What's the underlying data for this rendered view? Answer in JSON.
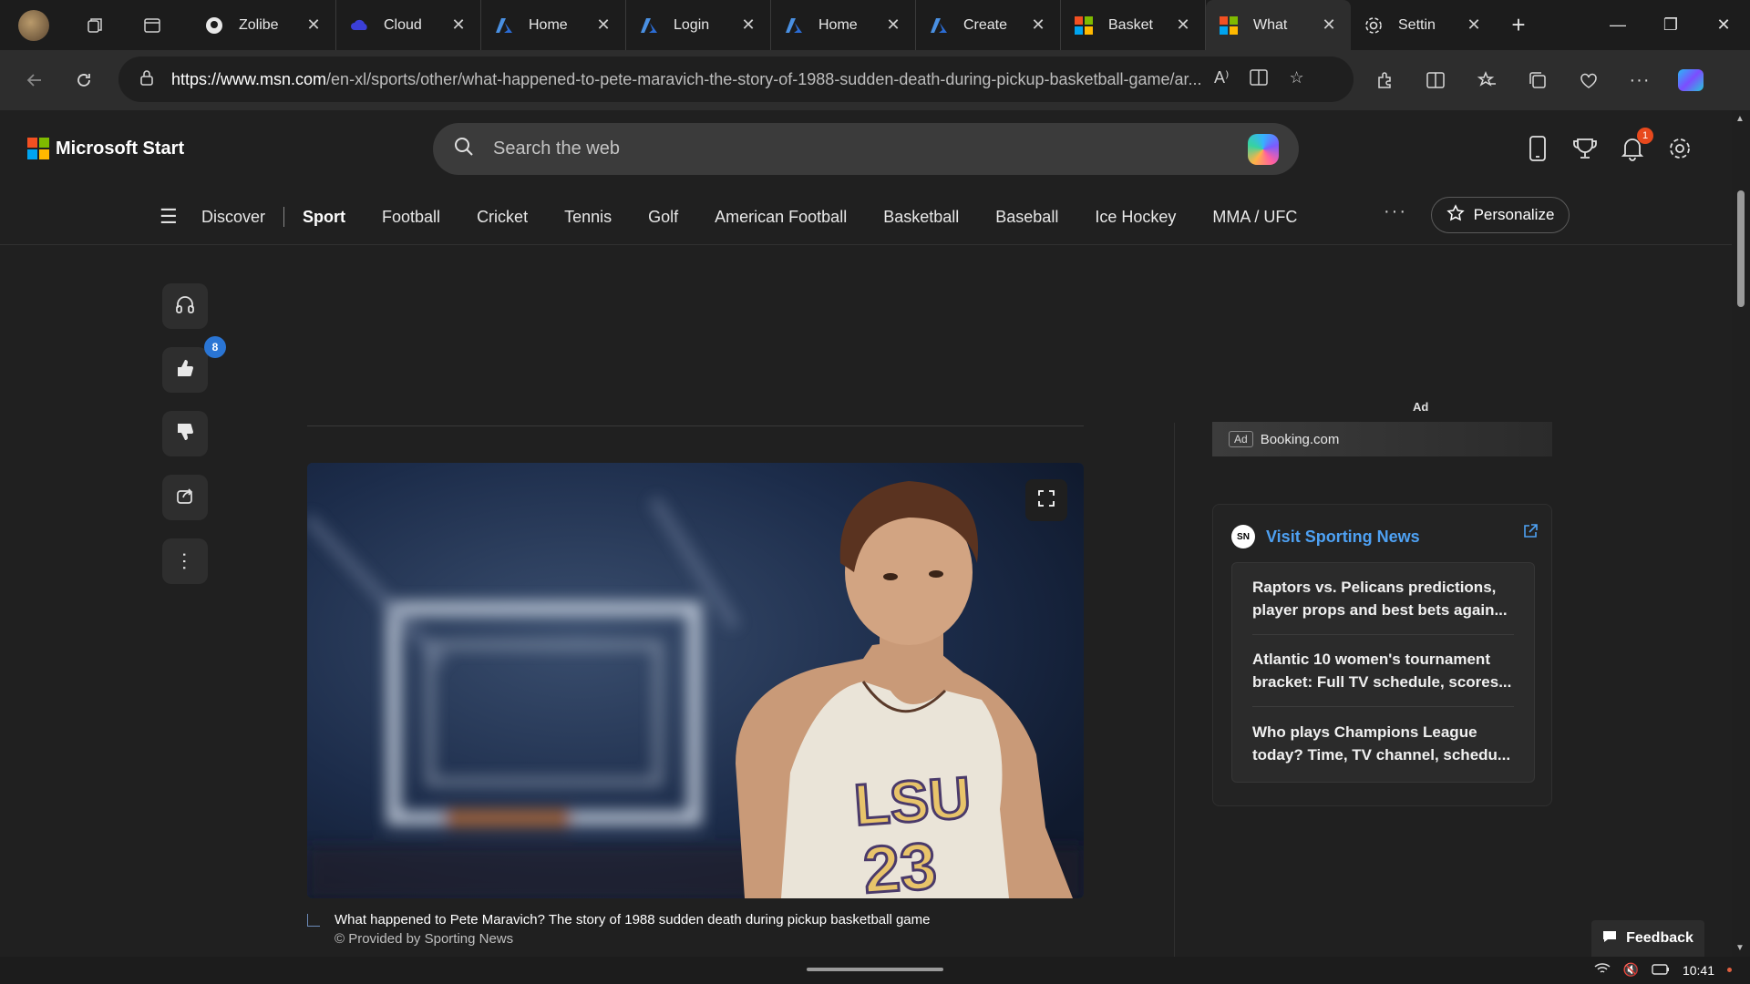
{
  "browser": {
    "tabs": [
      {
        "label": "Zolibe",
        "favicon": "github-icon",
        "active": false
      },
      {
        "label": "Cloud",
        "favicon": "cloud-icon",
        "active": false
      },
      {
        "label": "Home",
        "favicon": "azure-icon",
        "active": false
      },
      {
        "label": "Login",
        "favicon": "azure-icon",
        "active": false
      },
      {
        "label": "Home",
        "favicon": "azure-icon",
        "active": false
      },
      {
        "label": "Create",
        "favicon": "azure-icon",
        "active": false
      },
      {
        "label": "Basket",
        "favicon": "microsoft-icon",
        "active": false
      },
      {
        "label": "What",
        "favicon": "microsoft-icon",
        "active": true
      },
      {
        "label": "Settin",
        "favicon": "gear-icon",
        "active": false
      }
    ],
    "url_host": "https://www.msn.com",
    "url_path": "/en-xl/sports/other/what-happened-to-pete-maravich-the-story-of-1988-sudden-death-during-pickup-basketball-game/ar..."
  },
  "site": {
    "logo_text": "Microsoft Start",
    "search_placeholder": "Search the web",
    "notification_count": "1"
  },
  "nav": {
    "items": [
      {
        "label": "Discover",
        "active": false
      },
      {
        "label": "Sport",
        "active": true
      },
      {
        "label": "Football",
        "active": false
      },
      {
        "label": "Cricket",
        "active": false
      },
      {
        "label": "Tennis",
        "active": false
      },
      {
        "label": "Golf",
        "active": false
      },
      {
        "label": "American Football",
        "active": false
      },
      {
        "label": "Basketball",
        "active": false
      },
      {
        "label": "Baseball",
        "active": false
      },
      {
        "label": "Ice Hockey",
        "active": false
      },
      {
        "label": "MMA / UFC",
        "active": false
      }
    ],
    "more": "···",
    "personalize_label": "Personalize"
  },
  "actions": {
    "like_count": "8"
  },
  "article": {
    "image_alt": "Pete Maravich in LSU 23 jersey",
    "jersey_text": "LSU 23",
    "caption_title": "What happened to Pete Maravich? The story of 1988 sudden death during pickup basketball game",
    "caption_credit": "© Provided by Sporting News"
  },
  "sidebar": {
    "ad_label": "Ad",
    "ad_tag": "Ad",
    "ad_source": "Booking.com",
    "sn_title": "Visit Sporting News",
    "sn_logo": "SN",
    "headlines": [
      "Raptors vs. Pelicans predictions, player props and best bets again...",
      "Atlantic 10 women's tournament bracket: Full TV schedule, scores...",
      "Who plays Champions League today? Time, TV channel, schedu..."
    ]
  },
  "feedback_label": "Feedback",
  "taskbar": {
    "time": "10:41"
  },
  "colors": {
    "accent_link": "#4ea1f3",
    "badge_blue": "#2a75d4",
    "badge_red": "#e8491d"
  }
}
